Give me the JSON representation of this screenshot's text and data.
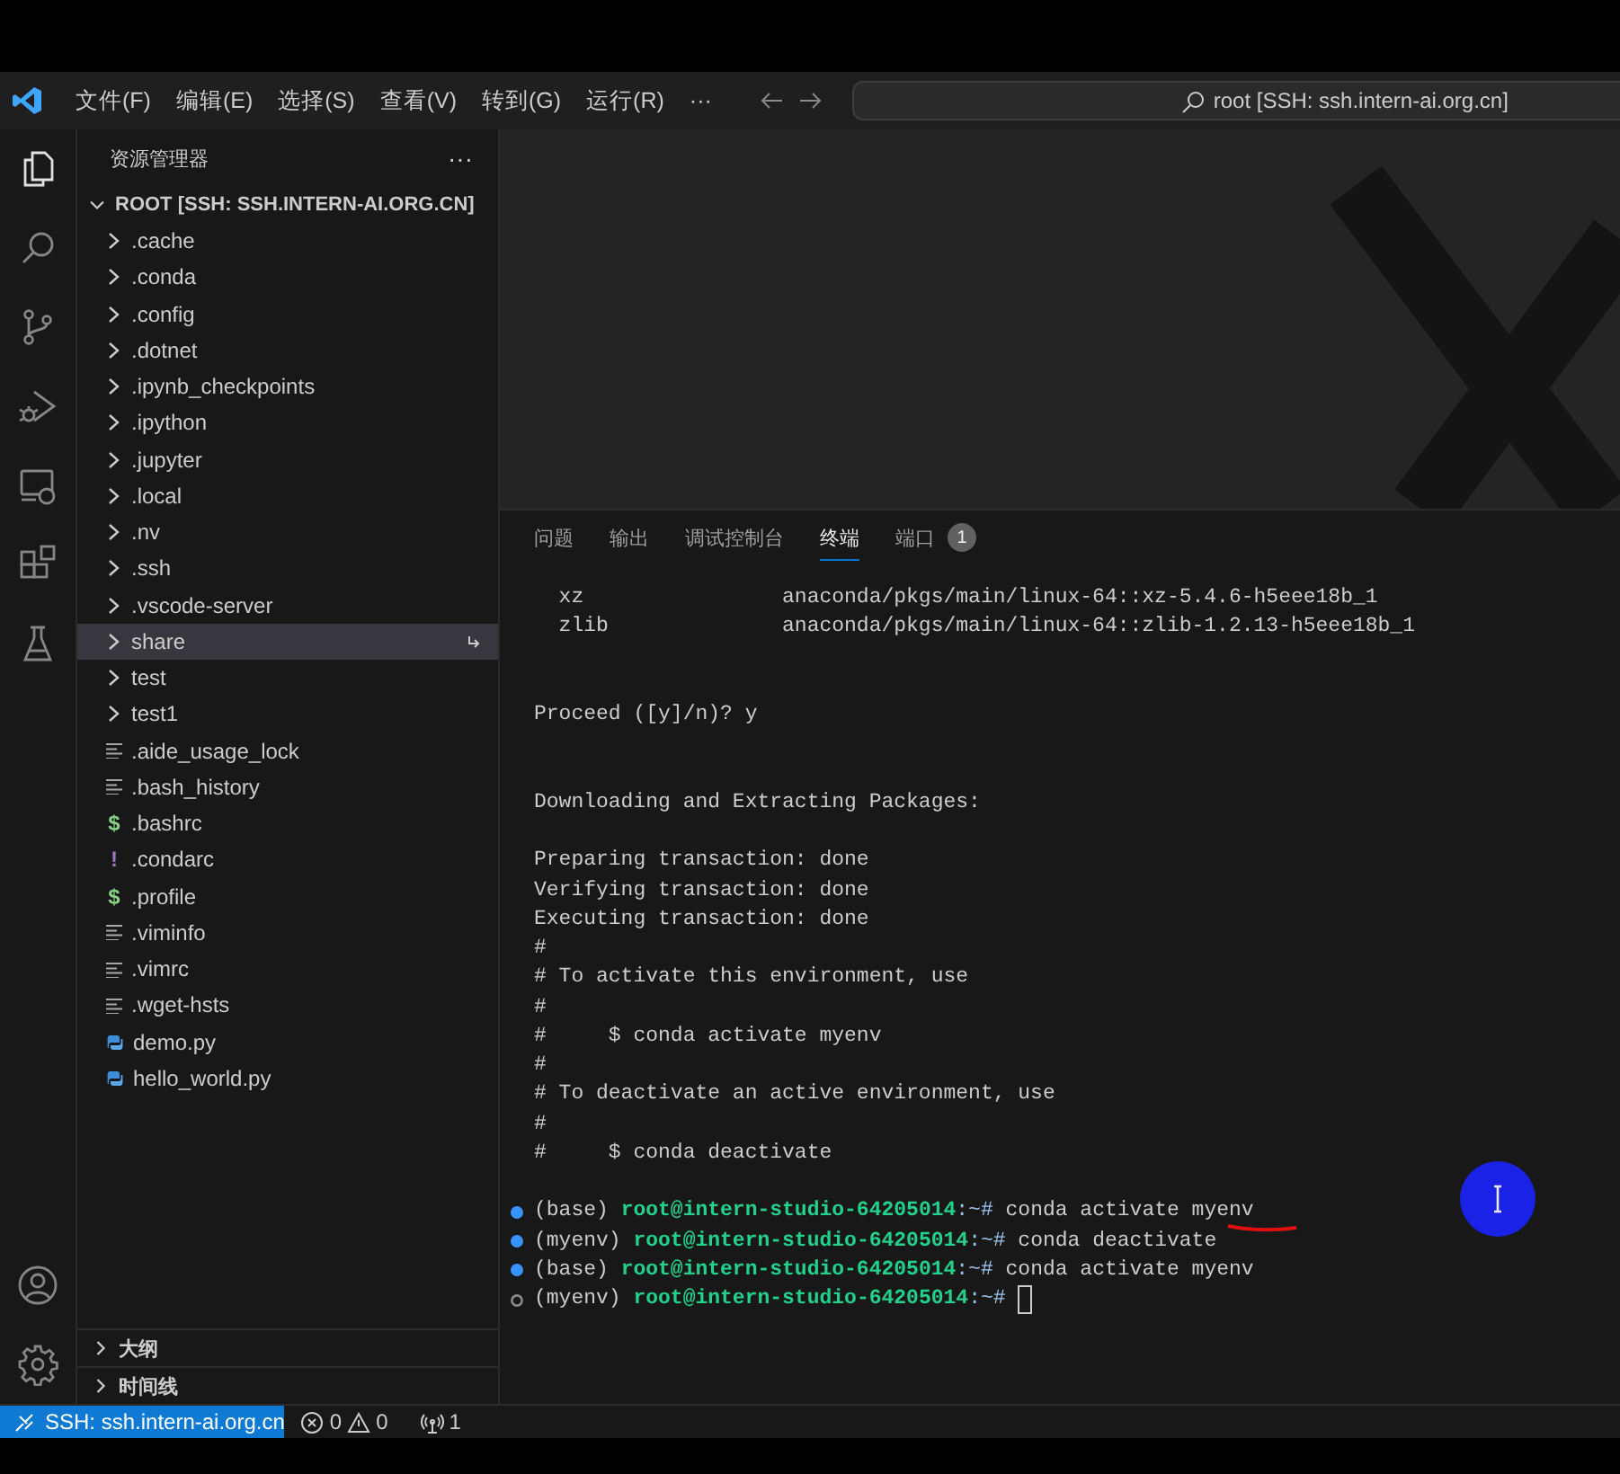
{
  "title_bar": {
    "menu": [
      "文件(F)",
      "编辑(E)",
      "选择(S)",
      "查看(V)",
      "转到(G)",
      "运行(R)",
      "···"
    ],
    "search": "root [SSH: ssh.intern-ai.org.cn]"
  },
  "activity_bar": {
    "items": [
      {
        "kind": "explorer",
        "selected": true
      },
      {
        "kind": "search",
        "selected": false
      },
      {
        "kind": "source-control",
        "selected": false
      },
      {
        "kind": "run-debug",
        "selected": false
      },
      {
        "kind": "remote",
        "selected": false
      },
      {
        "kind": "extensions",
        "selected": false
      },
      {
        "kind": "testing",
        "selected": false
      }
    ],
    "bottom": [
      {
        "kind": "account"
      },
      {
        "kind": "settings"
      }
    ]
  },
  "explorer": {
    "title": "资源管理器",
    "more": "···",
    "root": {
      "label": "ROOT [SSH: SSH.INTERN-AI.ORG.CN]",
      "expanded": true
    },
    "items": [
      {
        "name": ".cache",
        "kind": "folder",
        "expanded": false,
        "selected": false
      },
      {
        "name": ".conda",
        "kind": "folder",
        "expanded": false,
        "selected": false
      },
      {
        "name": ".config",
        "kind": "folder",
        "expanded": false,
        "selected": false
      },
      {
        "name": ".dotnet",
        "kind": "folder",
        "expanded": false,
        "selected": false
      },
      {
        "name": ".ipynb_checkpoints",
        "kind": "folder",
        "expanded": false,
        "selected": false
      },
      {
        "name": ".ipython",
        "kind": "folder",
        "expanded": false,
        "selected": false
      },
      {
        "name": ".jupyter",
        "kind": "folder",
        "expanded": false,
        "selected": false
      },
      {
        "name": ".local",
        "kind": "folder",
        "expanded": false,
        "selected": false
      },
      {
        "name": ".nv",
        "kind": "folder",
        "expanded": false,
        "selected": false
      },
      {
        "name": ".ssh",
        "kind": "folder",
        "expanded": false,
        "selected": false
      },
      {
        "name": ".vscode-server",
        "kind": "folder",
        "expanded": false,
        "selected": false
      },
      {
        "name": "share",
        "kind": "folder",
        "expanded": false,
        "selected": true
      },
      {
        "name": "test",
        "kind": "folder",
        "expanded": false,
        "selected": false
      },
      {
        "name": "test1",
        "kind": "folder",
        "expanded": false,
        "selected": false
      },
      {
        "name": ".aide_usage_lock",
        "kind": "text",
        "selected": false
      },
      {
        "name": ".bash_history",
        "kind": "text",
        "selected": false
      },
      {
        "name": ".bashrc",
        "kind": "shell",
        "glyph": "$",
        "selected": false
      },
      {
        "name": ".condarc",
        "kind": "config",
        "glyph": "!",
        "selected": false
      },
      {
        "name": ".profile",
        "kind": "shell",
        "glyph": "$",
        "selected": false
      },
      {
        "name": ".viminfo",
        "kind": "text",
        "selected": false
      },
      {
        "name": ".vimrc",
        "kind": "text",
        "selected": false
      },
      {
        "name": ".wget-hsts",
        "kind": "text",
        "selected": false
      },
      {
        "name": "demo.py",
        "kind": "python",
        "selected": false
      },
      {
        "name": "hello_world.py",
        "kind": "python",
        "selected": false
      }
    ],
    "sections": [
      {
        "label": "大纲",
        "expanded": false
      },
      {
        "label": "时间线",
        "expanded": false
      }
    ]
  },
  "panel": {
    "tabs": [
      {
        "label": "问题",
        "selected": false
      },
      {
        "label": "输出",
        "selected": false
      },
      {
        "label": "调试控制台",
        "selected": false
      },
      {
        "label": "终端",
        "selected": true
      },
      {
        "label": "端口",
        "selected": false,
        "badge": "1"
      }
    ],
    "terminal": {
      "lines": [
        {
          "kind": "output",
          "text": "  xz                anaconda/pkgs/main/linux-64::xz-5.4.6-h5eee18b_1"
        },
        {
          "kind": "output",
          "text": "  zlib              anaconda/pkgs/main/linux-64::zlib-1.2.13-h5eee18b_1"
        },
        {
          "kind": "blank"
        },
        {
          "kind": "blank"
        },
        {
          "kind": "output",
          "text": "Proceed ([y]/n)? y"
        },
        {
          "kind": "blank"
        },
        {
          "kind": "blank"
        },
        {
          "kind": "output",
          "text": "Downloading and Extracting Packages:"
        },
        {
          "kind": "blank"
        },
        {
          "kind": "output",
          "text": "Preparing transaction: done"
        },
        {
          "kind": "output",
          "text": "Verifying transaction: done"
        },
        {
          "kind": "output",
          "text": "Executing transaction: done"
        },
        {
          "kind": "output",
          "text": "#"
        },
        {
          "kind": "output",
          "text": "# To activate this environment, use"
        },
        {
          "kind": "output",
          "text": "#"
        },
        {
          "kind": "output",
          "text": "#     $ conda activate myenv"
        },
        {
          "kind": "output",
          "text": "#"
        },
        {
          "kind": "output",
          "text": "# To deactivate an active environment, use"
        },
        {
          "kind": "output",
          "text": "#"
        },
        {
          "kind": "output",
          "text": "#     $ conda deactivate"
        },
        {
          "kind": "blank"
        },
        {
          "kind": "prompt",
          "done": true,
          "env": "(base)",
          "user": "root@intern-studio-64205014",
          "path": ":~#",
          "command": "conda activate myenv",
          "cursor": false
        },
        {
          "kind": "prompt",
          "done": true,
          "env": "(myenv)",
          "user": "root@intern-studio-64205014",
          "path": ":~#",
          "command": "conda deactivate",
          "cursor": false
        },
        {
          "kind": "prompt",
          "done": true,
          "env": "(base)",
          "user": "root@intern-studio-64205014",
          "path": ":~#",
          "command": "conda activate myenv",
          "cursor": false
        },
        {
          "kind": "prompt",
          "done": false,
          "env": "(myenv)",
          "user": "root@intern-studio-64205014",
          "path": ":~#",
          "cursor": true
        }
      ]
    }
  },
  "status_bar": {
    "remote": "SSH: ssh.intern-ai.org.cn",
    "errors": "0",
    "warnings": "0",
    "ports": "1"
  }
}
